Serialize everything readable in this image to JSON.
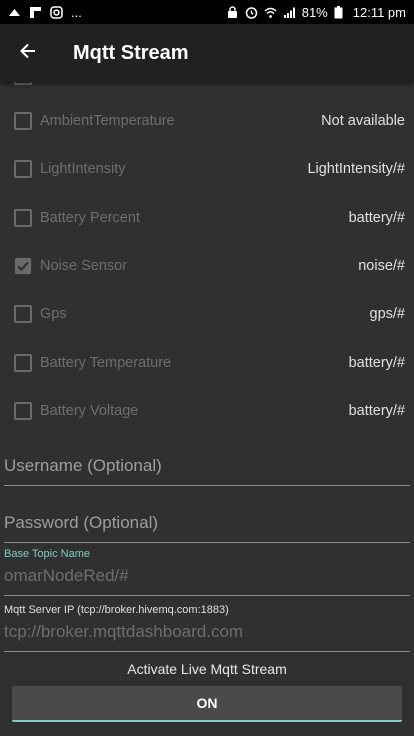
{
  "status_bar": {
    "notif_more": "...",
    "battery_percent": "81%",
    "time": "12:11 pm"
  },
  "app_bar": {
    "title": "Mqtt Stream",
    "back_icon": "arrow-left-icon"
  },
  "sensors": [
    {
      "label": "AmbientTemperature",
      "topic": "Not available",
      "checked": false
    },
    {
      "label": "LightIntensity",
      "topic": "LightIntensity/#",
      "checked": false
    },
    {
      "label": "Battery Percent",
      "topic": "battery/#",
      "checked": false
    },
    {
      "label": "Noise Sensor",
      "topic": "noise/#",
      "checked": true
    },
    {
      "label": "Gps",
      "topic": "gps/#",
      "checked": false
    },
    {
      "label": "Battery Temperature",
      "topic": "battery/#",
      "checked": false
    },
    {
      "label": "Battery Voltage",
      "topic": "battery/#",
      "checked": false
    }
  ],
  "form": {
    "username_placeholder": "Username (Optional)",
    "password_placeholder": "Password (Optional)",
    "base_topic_label": "Base Topic Name",
    "base_topic_value": "omarNodeRed/#",
    "server_label": "Mqtt Server IP (tcp://broker.hivemq.com:1883)",
    "server_value": "tcp://broker.mqttdashboard.com"
  },
  "activate": {
    "label": "Activate Live Mqtt Stream",
    "button": "ON"
  },
  "colors": {
    "accent": "#80cbc4",
    "background": "#303030",
    "app_bar": "#212121"
  }
}
